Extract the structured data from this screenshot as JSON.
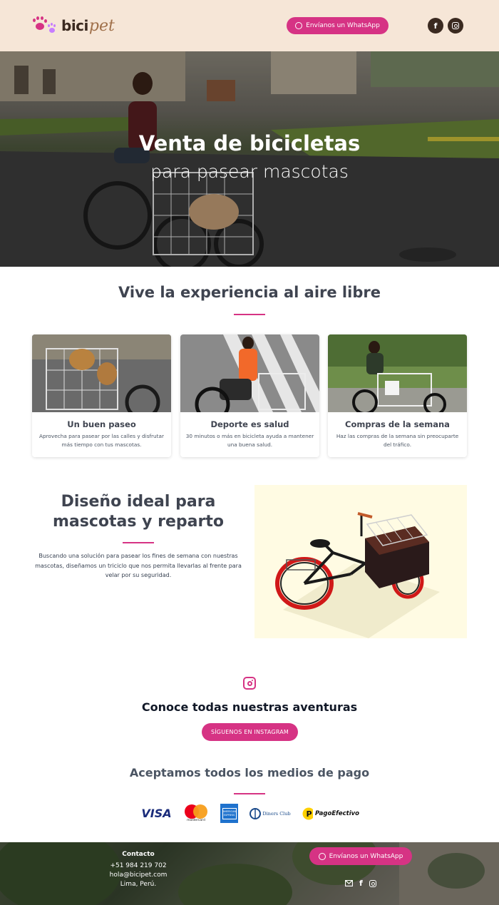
{
  "header": {
    "logo_bici": "bici",
    "logo_pet": "pet",
    "whatsapp_label": "Envíanos un WhatsApp",
    "social": [
      "facebook-icon",
      "instagram-icon"
    ]
  },
  "hero": {
    "title": "Venta de bicicletas",
    "subtitle": "para pasear mascotas"
  },
  "experience": {
    "title": "Vive la experiencia al aire libre",
    "cards": [
      {
        "title": "Un buen paseo",
        "text": "Aprovecha para pasear por las calles y disfrutar más tiempo con tus mascotas."
      },
      {
        "title": "Deporte es salud",
        "text": "30 minutos o más en bicicleta ayuda a mantener una buena salud."
      },
      {
        "title": "Compras de la semana",
        "text": "Haz las compras de la semana sin preocuparte del tráfico."
      }
    ]
  },
  "design": {
    "title_line1": "Diseño ideal para",
    "title_line2": "mascotas y reparto",
    "text": "Buscando una solución para pasear los fines de semana con nuestras mascotas, diseñamos un triciclo que nos permita llevarlas al frente para velar por su seguridad."
  },
  "instagram": {
    "title": "Conoce todas nuestras aventuras",
    "button": "SÍGUENOS EN INSTAGRAM"
  },
  "payments": {
    "title": "Aceptamos todos los medios de pago",
    "visa": "VISA",
    "mastercard": "mastercard",
    "amex": "AMERICAN EXPRESS",
    "diners": "Diners Club",
    "pagoefectivo": "PagoEfectivo"
  },
  "footer": {
    "heading": "Contacto",
    "phone": "+51 984 219 702",
    "email": "hola@bicipet.com",
    "location": "Lima, Perú.",
    "whatsapp_label": "Envíanos un WhatsApp"
  },
  "colors": {
    "accent": "#d63384",
    "header_bg": "#f6e6d7",
    "brand_dark": "#3b2a20",
    "heading": "#3f4450"
  }
}
